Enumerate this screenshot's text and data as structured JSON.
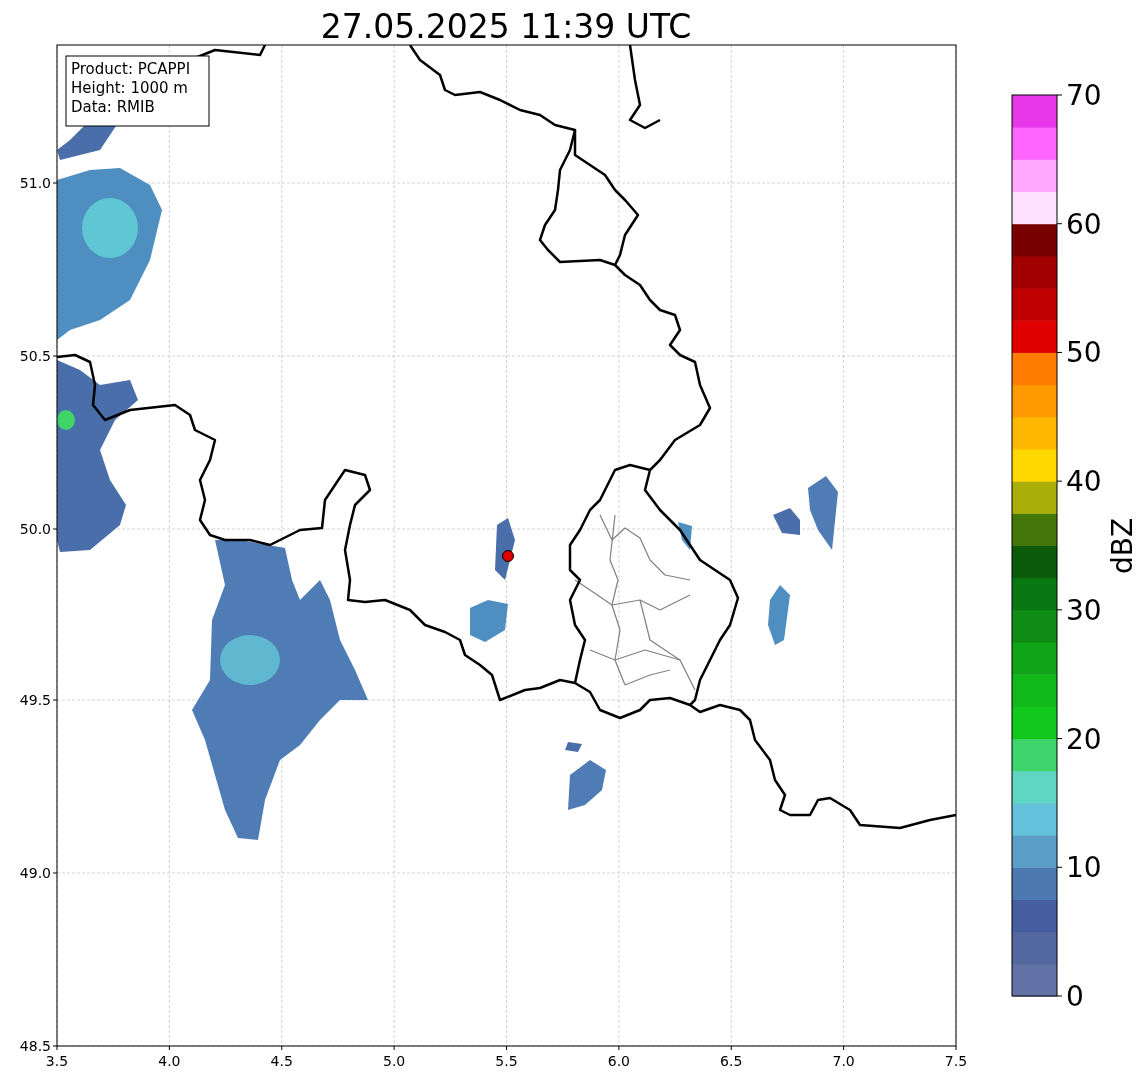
{
  "title": "27.05.2025 11:39 UTC",
  "map": {
    "info_lines": [
      "Product: PCAPPI",
      "Height: 1000 m",
      "Data: RMIB"
    ],
    "x_ticks": [
      "3.5",
      "4.0",
      "4.5",
      "5.0",
      "5.5",
      "6.0",
      "6.5",
      "7.0",
      "7.5"
    ],
    "y_ticks": [
      "51.0",
      "50.5",
      "50.0",
      "49.5",
      "49.0",
      "48.5"
    ]
  },
  "colorbar": {
    "label": "dBZ",
    "ticks": [
      "70",
      "60",
      "50",
      "40",
      "30",
      "20",
      "10",
      "0"
    ],
    "levels": [
      {
        "color": "#6272a6"
      },
      {
        "color": "#52689e"
      },
      {
        "color": "#445ea0"
      },
      {
        "color": "#4c7ab0"
      },
      {
        "color": "#5a9dc6"
      },
      {
        "color": "#64c2dc"
      },
      {
        "color": "#5fd6c2"
      },
      {
        "color": "#3dd46c"
      },
      {
        "color": "#12c81c"
      },
      {
        "color": "#10b81a"
      },
      {
        "color": "#10a418"
      },
      {
        "color": "#0e8c14"
      },
      {
        "color": "#0a7812"
      },
      {
        "color": "#0a5a0a"
      },
      {
        "color": "#44760a"
      },
      {
        "color": "#aaae08"
      },
      {
        "color": "#ffd800"
      },
      {
        "color": "#ffb800"
      },
      {
        "color": "#ff9a00"
      },
      {
        "color": "#ff7c00"
      },
      {
        "color": "#e00000"
      },
      {
        "color": "#c00000"
      },
      {
        "color": "#a00000"
      },
      {
        "color": "#780000"
      },
      {
        "color": "#ffe0ff"
      },
      {
        "color": "#ffaaff"
      },
      {
        "color": "#ff66ff"
      },
      {
        "color": "#e837e8"
      }
    ]
  }
}
